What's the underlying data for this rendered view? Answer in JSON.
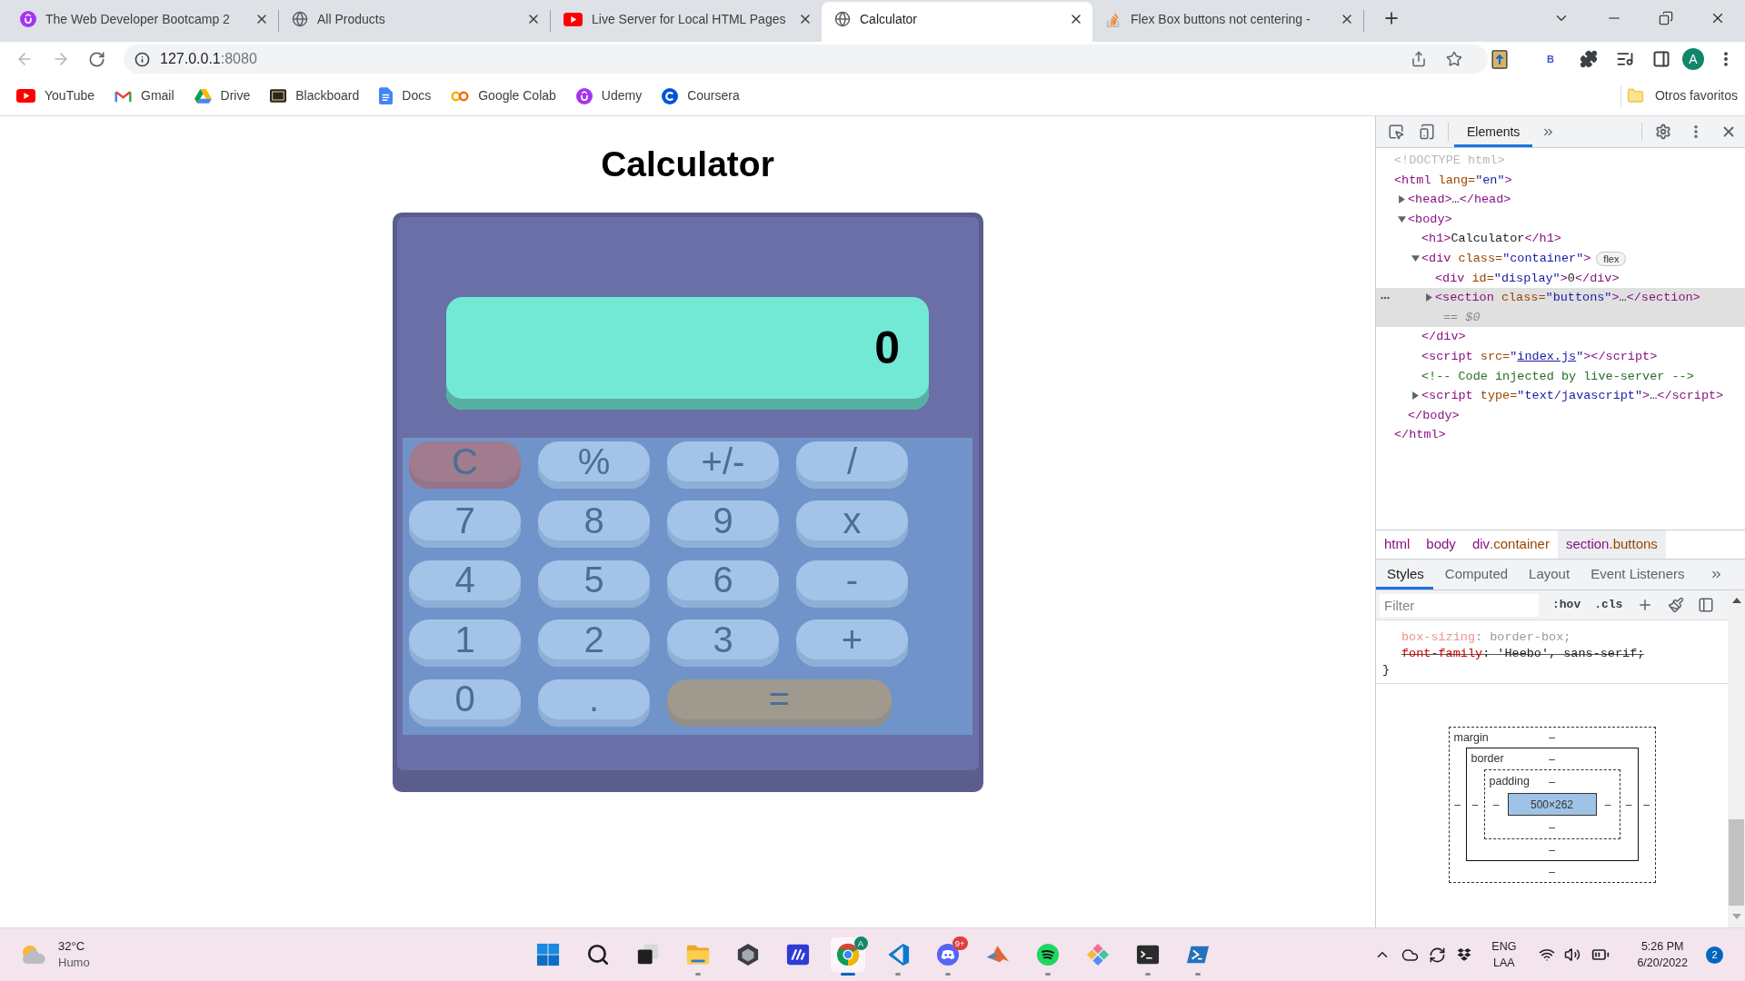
{
  "browser": {
    "tabs": [
      {
        "kind": "udemy",
        "title": "The Web Developer Bootcamp 2",
        "selected": false
      },
      {
        "kind": "globe",
        "title": "All Products",
        "selected": false
      },
      {
        "kind": "youtube",
        "title": "Live Server for Local HTML Pages",
        "selected": false
      },
      {
        "kind": "globe",
        "title": "Calculator",
        "selected": true
      },
      {
        "kind": "stack",
        "title": "Flex Box buttons not centering -",
        "selected": false
      }
    ],
    "address": {
      "host": "127.0.0.1",
      "port": ":8080"
    },
    "extension_letter": "B",
    "profile_initial": "A",
    "bookmarks": [
      {
        "kind": "youtube",
        "label": "YouTube"
      },
      {
        "kind": "gmail",
        "label": "Gmail"
      },
      {
        "kind": "drive",
        "label": "Drive"
      },
      {
        "kind": "blackboard",
        "label": "Blackboard"
      },
      {
        "kind": "docs",
        "label": "Docs"
      },
      {
        "kind": "colab",
        "label": "Google Colab"
      },
      {
        "kind": "udemy",
        "label": "Udemy"
      },
      {
        "kind": "coursera",
        "label": "Coursera"
      }
    ],
    "other_bookmarks": "Otros favoritos"
  },
  "page": {
    "title": "Calculator",
    "display": "0",
    "keys": [
      {
        "label": "C",
        "kind": "clear"
      },
      {
        "label": "%",
        "kind": "key"
      },
      {
        "label": "+/-",
        "kind": "key"
      },
      {
        "label": "/",
        "kind": "key"
      },
      {
        "label": "7",
        "kind": "key"
      },
      {
        "label": "8",
        "kind": "key"
      },
      {
        "label": "9",
        "kind": "key"
      },
      {
        "label": "x",
        "kind": "key"
      },
      {
        "label": "4",
        "kind": "key"
      },
      {
        "label": "5",
        "kind": "key"
      },
      {
        "label": "6",
        "kind": "key"
      },
      {
        "label": "-",
        "kind": "key"
      },
      {
        "label": "1",
        "kind": "key"
      },
      {
        "label": "2",
        "kind": "key"
      },
      {
        "label": "3",
        "kind": "key"
      },
      {
        "label": "+",
        "kind": "key"
      },
      {
        "label": "0",
        "kind": "key"
      },
      {
        "label": ".",
        "kind": "key"
      },
      {
        "label": "=",
        "kind": "equals"
      }
    ]
  },
  "devtools": {
    "panel_tabs": [
      {
        "label": "Elements",
        "selected": true
      }
    ],
    "tree": [
      {
        "selected": false,
        "parts": [
          {
            "kind": "doctype",
            "text": "<!DOCTYPE html>"
          }
        ]
      },
      {
        "selected": false,
        "parts": [
          {
            "kind": "tag",
            "text": "<html"
          },
          {
            "kind": "attr",
            "text": " lang="
          },
          {
            "kind": "value",
            "text": "\"en\""
          },
          {
            "kind": "tag",
            "text": ">"
          }
        ],
        "children": [
          {
            "selected": false,
            "expanded": false,
            "parts": [
              {
                "kind": "tag",
                "text": "<head>"
              },
              {
                "kind": "text",
                "text": "…"
              },
              {
                "kind": "tag",
                "text": "</head>"
              }
            ]
          },
          {
            "selected": false,
            "expanded": true,
            "parts": [
              {
                "kind": "tag",
                "text": "<body>"
              }
            ],
            "children": [
              {
                "selected": false,
                "parts": [
                  {
                    "kind": "tag",
                    "text": "<h1>"
                  },
                  {
                    "kind": "text",
                    "text": "Calculator"
                  },
                  {
                    "kind": "tag",
                    "text": "</h1>"
                  }
                ]
              },
              {
                "selected": false,
                "expanded": true,
                "badge": "flex",
                "parts": [
                  {
                    "kind": "tag",
                    "text": "<div"
                  },
                  {
                    "kind": "attr",
                    "text": " class="
                  },
                  {
                    "kind": "value",
                    "text": "\"container\""
                  },
                  {
                    "kind": "tag",
                    "text": ">"
                  }
                ],
                "children": [
                  {
                    "selected": false,
                    "parts": [
                      {
                        "kind": "tag",
                        "text": "<div"
                      },
                      {
                        "kind": "attr",
                        "text": " id="
                      },
                      {
                        "kind": "value",
                        "text": "\"display\""
                      },
                      {
                        "kind": "tag",
                        "text": ">"
                      },
                      {
                        "kind": "text",
                        "text": "0"
                      },
                      {
                        "kind": "tag",
                        "text": "</div>"
                      }
                    ]
                  },
                  {
                    "selected": true,
                    "expanded": false,
                    "note": "== $0",
                    "parts": [
                      {
                        "kind": "tag",
                        "text": "<section"
                      },
                      {
                        "kind": "attr",
                        "text": " class="
                      },
                      {
                        "kind": "value",
                        "text": "\"buttons\""
                      },
                      {
                        "kind": "tag",
                        "text": ">"
                      },
                      {
                        "kind": "text",
                        "text": "…"
                      },
                      {
                        "kind": "tag",
                        "text": "</section>"
                      }
                    ]
                  }
                ],
                "close": [
                  {
                    "kind": "tag",
                    "text": "</div>"
                  }
                ]
              },
              {
                "selected": false,
                "parts": [
                  {
                    "kind": "tag",
                    "text": "<script"
                  },
                  {
                    "kind": "attr",
                    "text": " src="
                  },
                  {
                    "kind": "value",
                    "text": "\""
                  },
                  {
                    "kind": "link",
                    "text": "index.js"
                  },
                  {
                    "kind": "value",
                    "text": "\""
                  },
                  {
                    "kind": "tag",
                    "text": "></script>"
                  }
                ]
              },
              {
                "selected": false,
                "parts": [
                  {
                    "kind": "comment",
                    "text": "<!-- Code injected by live-server -->"
                  }
                ]
              },
              {
                "selected": false,
                "expanded": false,
                "parts": [
                  {
                    "kind": "tag",
                    "text": "<script"
                  },
                  {
                    "kind": "attr",
                    "text": " type="
                  },
                  {
                    "kind": "value",
                    "text": "\"text/javascript\""
                  },
                  {
                    "kind": "tag",
                    "text": ">"
                  },
                  {
                    "kind": "text",
                    "text": "…"
                  },
                  {
                    "kind": "tag",
                    "text": "</script>"
                  }
                ]
              }
            ],
            "close": [
              {
                "kind": "tag",
                "text": "</body>"
              }
            ]
          }
        ],
        "close": [
          {
            "kind": "tag",
            "text": "</html>"
          }
        ]
      }
    ],
    "breadcrumbs": [
      {
        "tag": "html",
        "selected": false
      },
      {
        "tag": "body",
        "selected": false
      },
      {
        "tag": "div",
        "class": ".container",
        "selected": false
      },
      {
        "tag": "section",
        "class": ".buttons",
        "selected": true
      }
    ],
    "sidebar_tabs": [
      {
        "label": "Styles",
        "selected": true
      },
      {
        "label": "Computed",
        "selected": false
      },
      {
        "label": "Layout",
        "selected": false
      },
      {
        "label": "Event Listeners",
        "selected": false
      }
    ],
    "filter": {
      "placeholder": "Filter"
    },
    "toggles": [
      ":hov",
      ".cls"
    ],
    "rule": {
      "declarations": [
        {
          "kind": "inherited",
          "property": "box-sizing",
          "value": ": border-box;"
        },
        {
          "kind": "overridden",
          "property": "font-family",
          "value": ": 'Heebo', sans-serif;"
        }
      ],
      "close": "}"
    },
    "box_model": {
      "margin": {
        "label": "margin",
        "top": "–",
        "right": "–",
        "bottom": "–",
        "left": "–"
      },
      "border": {
        "label": "border",
        "top": "–",
        "right": "–",
        "bottom": "–",
        "left": "–"
      },
      "padding": {
        "label": "padding",
        "top": "–",
        "right": "–",
        "bottom": "–",
        "left": "–"
      },
      "content": "500×262"
    }
  },
  "taskbar": {
    "weather": {
      "temperature": "32°C",
      "condition": "Humo"
    },
    "apps": [
      {
        "kind": "start",
        "running": false,
        "selected": false
      },
      {
        "kind": "search",
        "running": false,
        "selected": false
      },
      {
        "kind": "taskview",
        "running": false,
        "selected": false
      },
      {
        "kind": "explorer",
        "running": true,
        "selected": false
      },
      {
        "kind": "hexagon",
        "running": false,
        "selected": false
      },
      {
        "kind": "tile",
        "running": false,
        "selected": false
      },
      {
        "kind": "chrome",
        "running": true,
        "selected": true,
        "badge": "A"
      },
      {
        "kind": "vscode",
        "running": true,
        "selected": false
      },
      {
        "kind": "discord",
        "running": true,
        "selected": false,
        "badge": "9+"
      },
      {
        "kind": "matlab",
        "running": false,
        "selected": false
      },
      {
        "kind": "spotify",
        "running": true,
        "selected": false
      },
      {
        "kind": "git",
        "running": false,
        "selected": false
      },
      {
        "kind": "terminal",
        "running": true,
        "selected": false
      },
      {
        "kind": "powershell",
        "running": true,
        "selected": false
      }
    ],
    "tray": {
      "language": "ENG",
      "layout": "LAA",
      "time": "5:26 PM",
      "date": "6/20/2022",
      "notifications": "2"
    }
  }
}
